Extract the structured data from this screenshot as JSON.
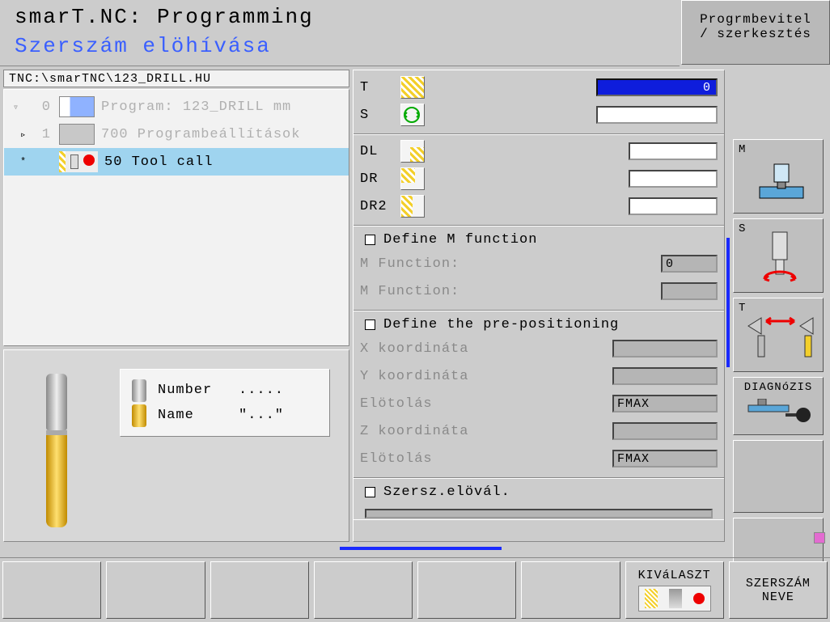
{
  "header": {
    "title1": "smarT.NC: Programming",
    "title2": "Szerszám elöhívása",
    "mode_line1": "Progrmbevitel",
    "mode_line2": "/ szerkesztés"
  },
  "path_bar": "TNC:\\smarTNC\\123_DRILL.HU",
  "tree": {
    "row0_expander": "▿",
    "row0_num": "0",
    "row0_text": "Program: 123_DRILL mm",
    "row1_expander": "▹",
    "row1_num": "1",
    "row1_text": "700 Programbeállítások",
    "row2_expander": "*",
    "row2_num": "",
    "row2_text": "50 Tool call"
  },
  "info": {
    "number_label": "Number",
    "number_value": ".....",
    "name_label": "Name",
    "name_value": "\"...\""
  },
  "form": {
    "t_label": "T",
    "t_value": "0",
    "s_label": "S",
    "s_value": "",
    "dl_label": "DL",
    "dl_value": "",
    "dr_label": "DR",
    "dr_value": "",
    "dr2_label": "DR2",
    "dr2_value": "",
    "m_check": "Define M function",
    "m_func1_label": "M Function:",
    "m_func1_value": "0",
    "m_func2_label": "M Function:",
    "m_func2_value": "",
    "prepos_check": "Define the pre-positioning",
    "x_label": "X koordináta",
    "y_label": "Y koordináta",
    "feed1_label": "Elötolás",
    "feed1_value": "FMAX",
    "z_label": "Z koordináta",
    "feed2_label": "Elötolás",
    "feed2_value": "FMAX",
    "presel_check": "Szersz.elövál."
  },
  "sidekeys": {
    "m": "M",
    "s": "S",
    "t": "T",
    "diag": "DIAGNóZIS"
  },
  "softkeys": {
    "select_label": "KIVáLASZT",
    "name_line1": "SZERSZÁM",
    "name_line2": "NEVE"
  }
}
